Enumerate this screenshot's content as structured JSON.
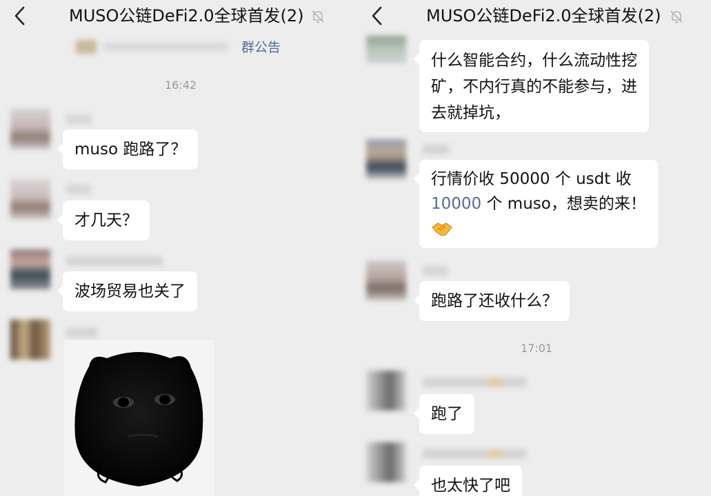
{
  "left": {
    "header": {
      "title": "MUSO公链DeFi2.0全球首发(2)"
    },
    "group_notice_label": "群公告",
    "time_1": "16:42",
    "messages": [
      {
        "text": "muso 跑路了？"
      },
      {
        "text": "才几天？"
      },
      {
        "text": "波场贸易也关了"
      }
    ]
  },
  "right": {
    "header": {
      "title": "MUSO公链DeFi2.0全球首发(2)"
    },
    "messages": [
      {
        "line1": "什么智能合约，什么流动性挖",
        "line2": "矿，不内行真的不能参与，进",
        "line3": "去就掉坑，"
      },
      {
        "line1": "行情价收 50000 个 usdt 收",
        "line2_link": "10000",
        "line2_rest": " 个 muso，想卖的来！",
        "emoji": "handshake-emoji"
      },
      {
        "text": "跑路了还收什么？"
      },
      {
        "text": "跑了"
      },
      {
        "text": "也太快了吧"
      }
    ],
    "time_2": "17:01"
  },
  "colors": {
    "background": "#ededed",
    "bubble": "#ffffff",
    "link": "#576b95",
    "timestamp": "#9a9a9a"
  },
  "icons": [
    "back-arrow-icon",
    "mute-bell-icon",
    "handshake-emoji"
  ]
}
